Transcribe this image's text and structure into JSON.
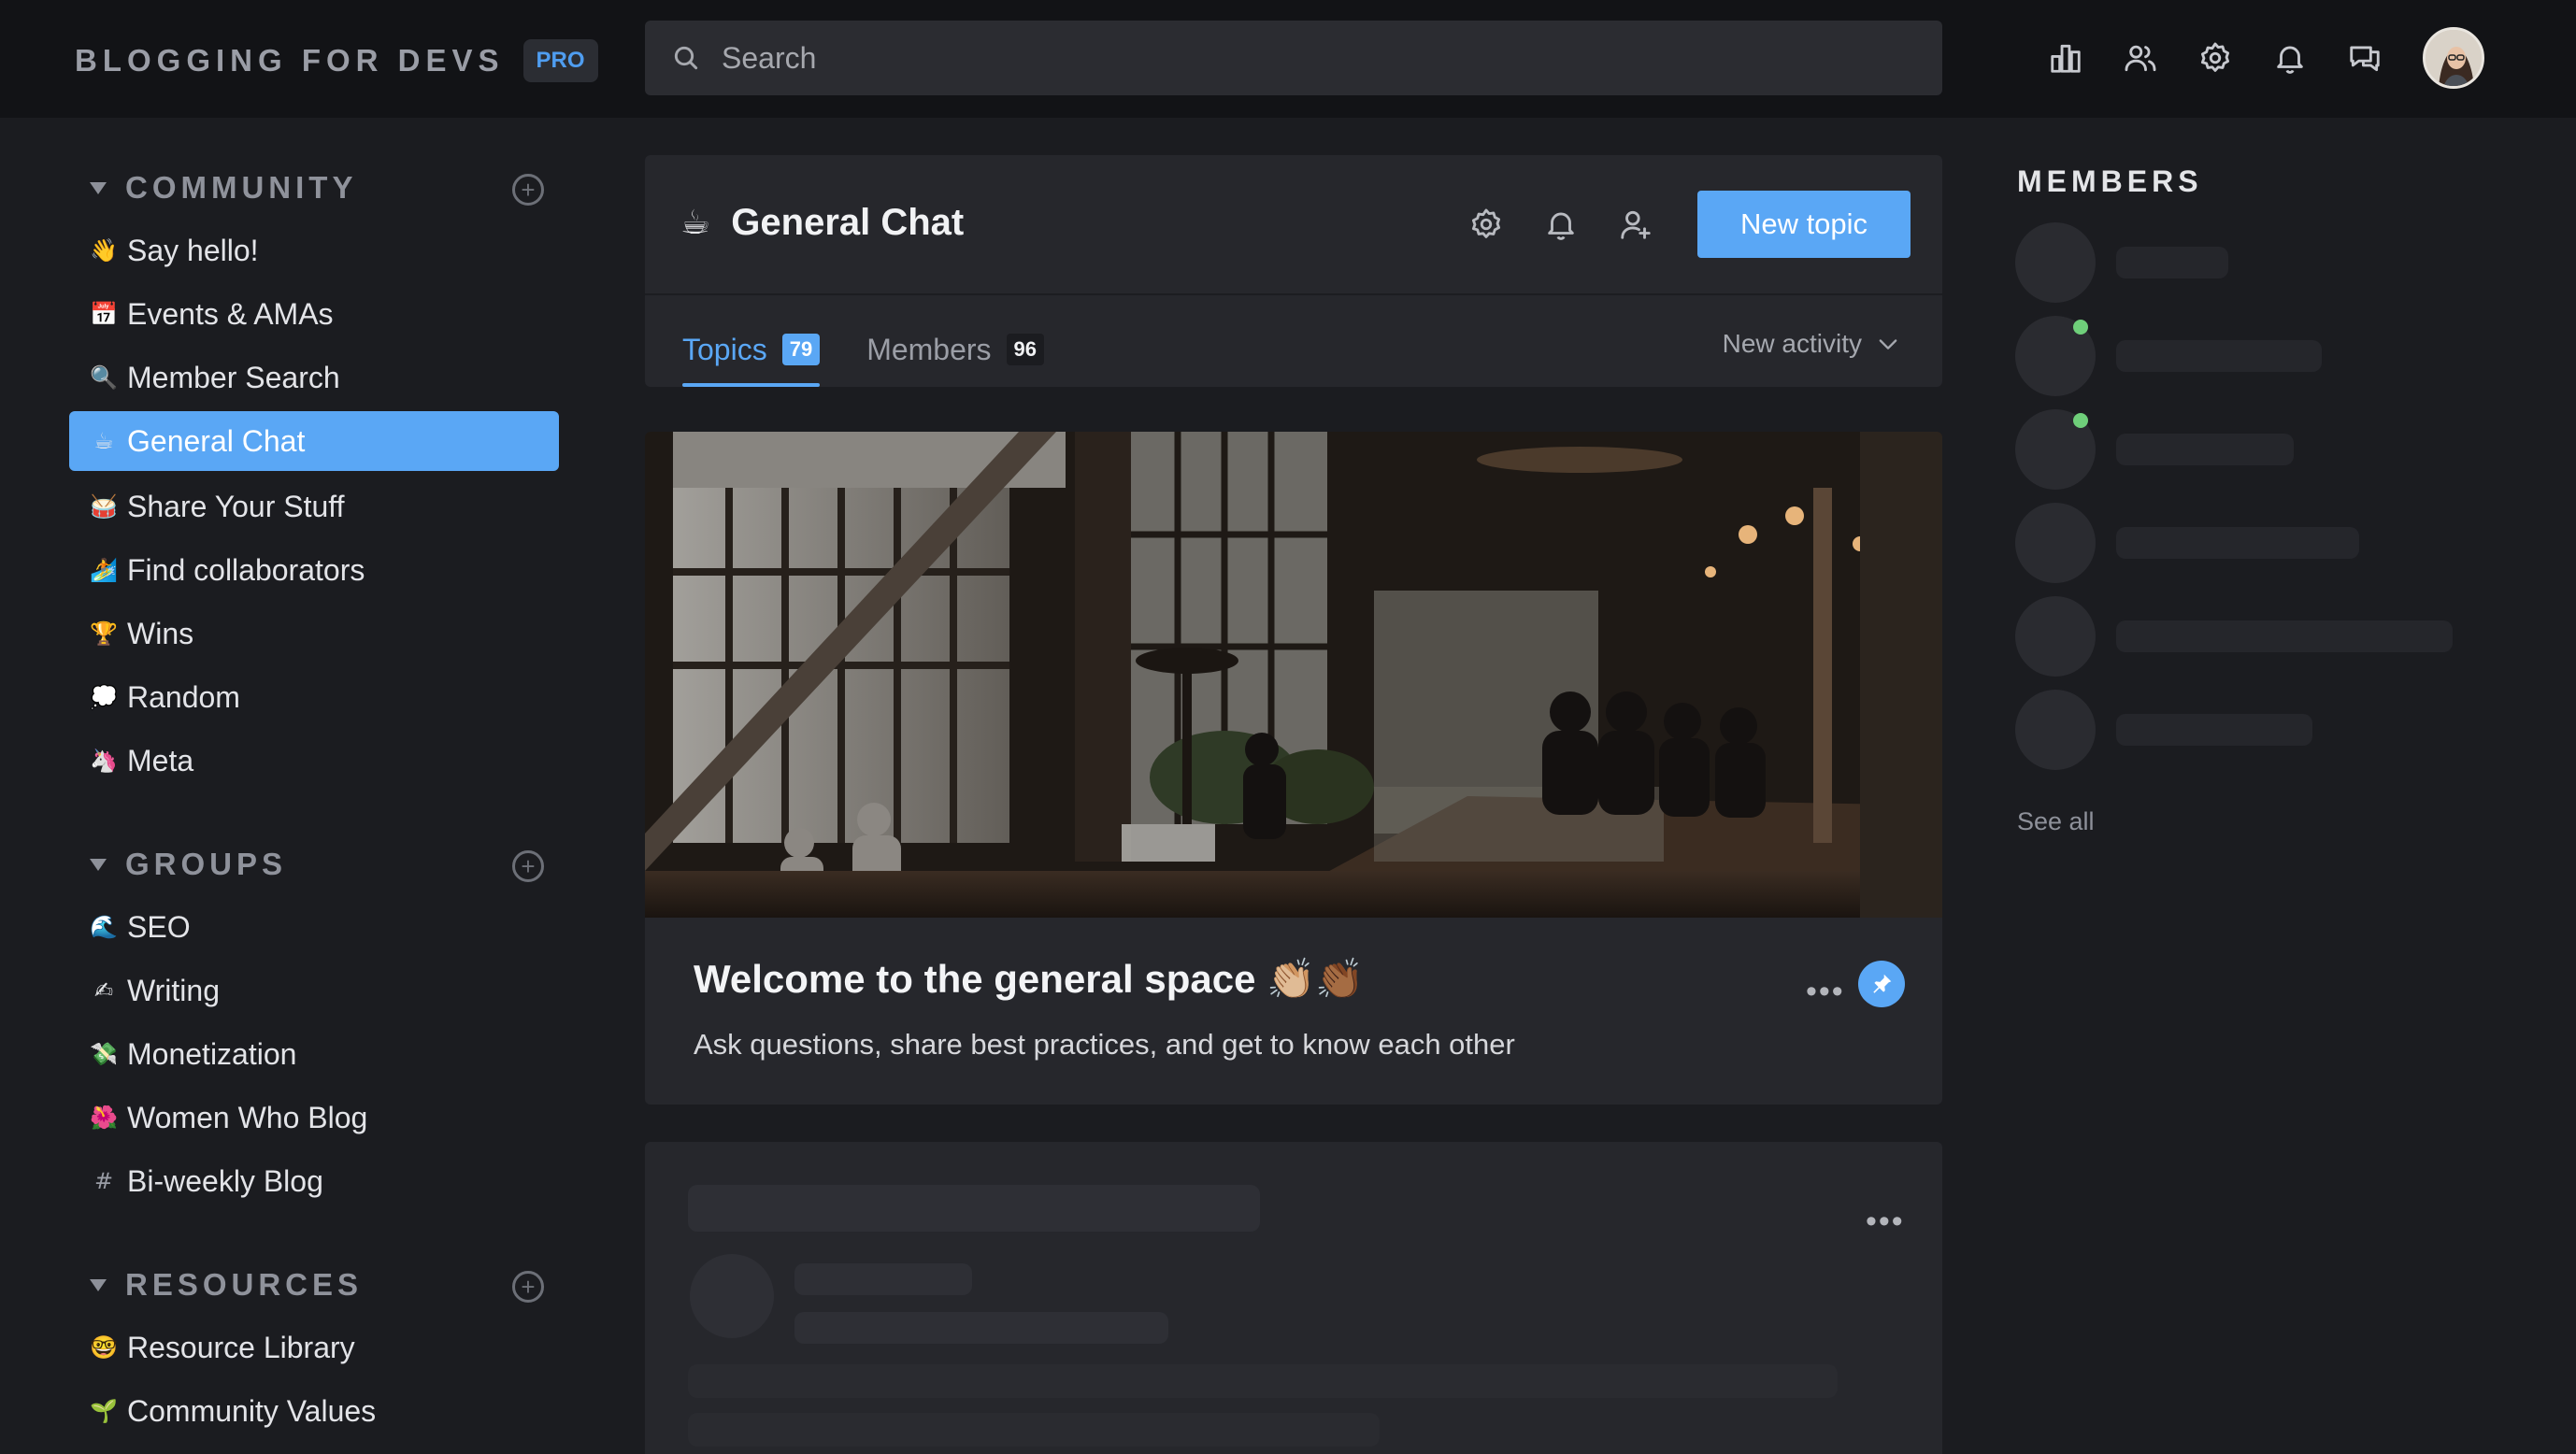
{
  "header": {
    "brand": "BLOGGING FOR DEVS",
    "badge": "PRO",
    "search_placeholder": "Search",
    "icons": [
      "leaderboard-icon",
      "members-icon",
      "settings-icon",
      "notifications-icon",
      "messages-icon"
    ]
  },
  "sidebar": {
    "sections": [
      {
        "title": "COMMUNITY",
        "items": [
          {
            "emoji": "👋",
            "label": "Say hello!"
          },
          {
            "emoji": "📅",
            "label": "Events & AMAs"
          },
          {
            "emoji": "🔍",
            "label": "Member Search"
          },
          {
            "emoji": "☕",
            "label": "General Chat",
            "active": true
          },
          {
            "emoji": "🥁",
            "label": "Share Your Stuff"
          },
          {
            "emoji": "🏄",
            "label": "Find collaborators"
          },
          {
            "emoji": "🏆",
            "label": "Wins"
          },
          {
            "emoji": "💭",
            "label": "Random"
          },
          {
            "emoji": "🦄",
            "label": "Meta"
          }
        ]
      },
      {
        "title": "GROUPS",
        "items": [
          {
            "emoji": "🌊",
            "label": "SEO"
          },
          {
            "emoji": "✍",
            "label": "Writing"
          },
          {
            "emoji": "💸",
            "label": "Monetization"
          },
          {
            "emoji": "🌺",
            "label": "Women Who Blog"
          },
          {
            "emoji": "#",
            "label": "Bi-weekly Blog"
          }
        ]
      },
      {
        "title": "RESOURCES",
        "items": [
          {
            "emoji": "🤓",
            "label": "Resource Library"
          },
          {
            "emoji": "🌱",
            "label": "Community Values"
          }
        ]
      }
    ]
  },
  "channel": {
    "emoji": "☕",
    "title": "General Chat",
    "new_topic_label": "New topic",
    "tabs": [
      {
        "label": "Topics",
        "count": "79",
        "active": true
      },
      {
        "label": "Members",
        "count": "96",
        "active": false
      }
    ],
    "sort_label": "New activity"
  },
  "post": {
    "title": "Welcome to the general space 👏🏼👏🏾",
    "subtitle": "Ask questions, share best practices, and get to know each other",
    "more": "•••",
    "pinned": true
  },
  "skeleton_post": {
    "more": "•••"
  },
  "members_panel": {
    "title": "MEMBERS",
    "see_all": "See all",
    "online": [
      false,
      true,
      true,
      false,
      false,
      false
    ]
  },
  "colors": {
    "accent": "#5aa7f5",
    "background": "#1b1c20",
    "card": "#26272c",
    "online": "#6fcf7a"
  }
}
